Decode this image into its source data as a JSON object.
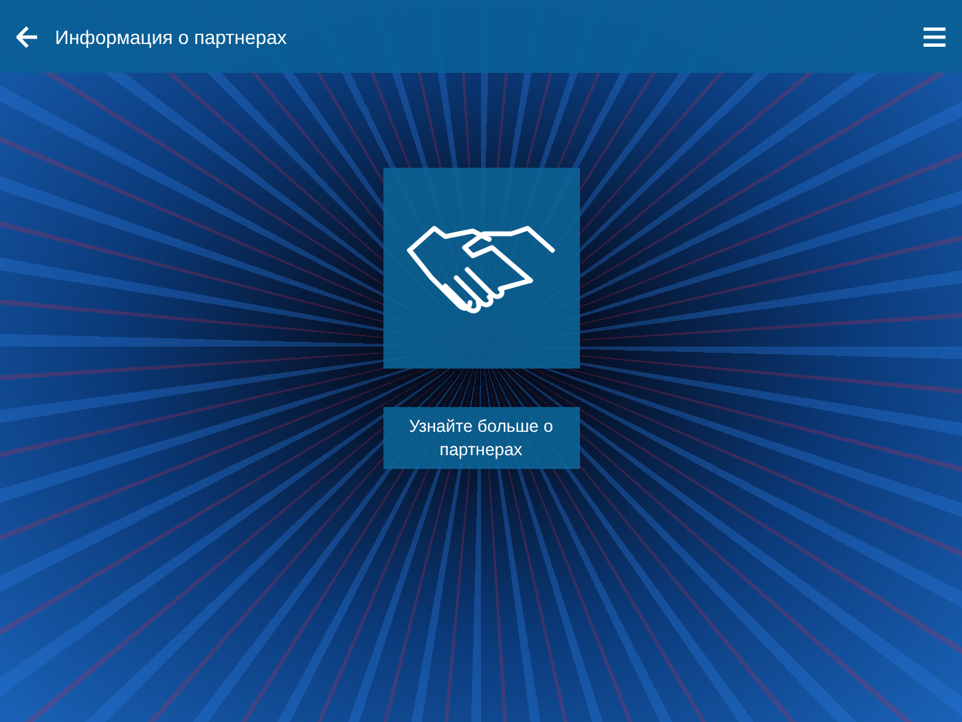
{
  "header": {
    "title": "Информация о партнерах"
  },
  "tile": {
    "label": "Узнайте больше о партнерах"
  }
}
